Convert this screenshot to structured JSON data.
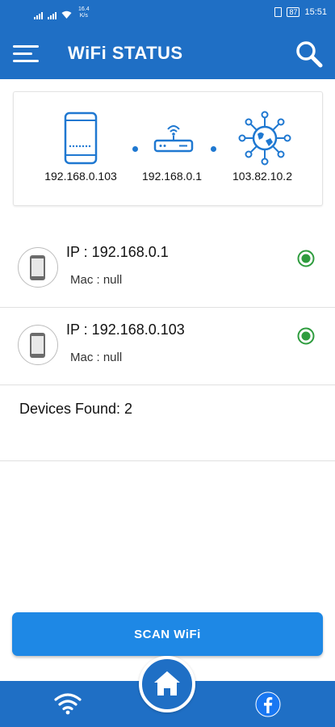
{
  "status_bar": {
    "speed_value": "16.4",
    "speed_unit": "K/s",
    "battery": "87",
    "time": "15:51"
  },
  "app_bar": {
    "title": "WiFi STATUS",
    "menu_icon": "hamburger-menu-icon",
    "search_icon": "search-icon"
  },
  "network_path": {
    "device_ip": "192.168.0.103",
    "router_ip": "192.168.0.1",
    "internet_ip": "103.82.10.2"
  },
  "devices": [
    {
      "ip_label": "IP : 192.168.0.1",
      "mac_label": "Mac : null",
      "online": true
    },
    {
      "ip_label": "IP : 192.168.0.103",
      "mac_label": "Mac : null",
      "online": true
    }
  ],
  "devices_found": "Devices Found: 2",
  "scan_button_label": "SCAN WiFi",
  "bottom_nav": {
    "left_icon": "wifi-icon",
    "center_icon": "home-icon",
    "right_icon": "facebook-icon"
  },
  "colors": {
    "primary": "#1f6fc5",
    "button": "#1e88e5",
    "online": "#2e9c3e"
  }
}
